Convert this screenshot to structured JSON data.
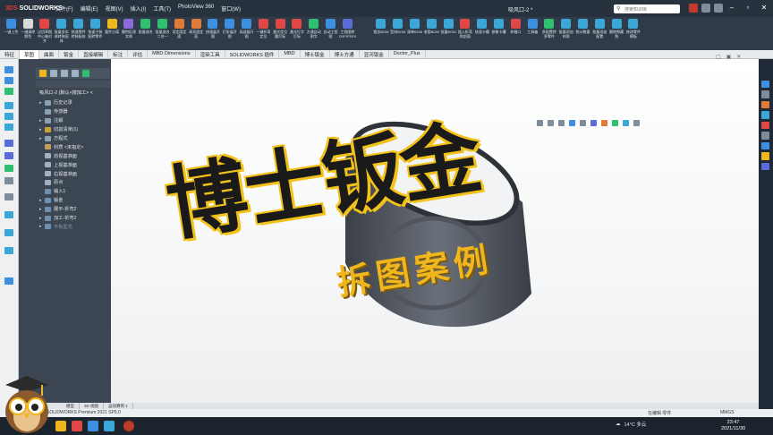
{
  "app": {
    "brand_prefix": "3DS",
    "brand": "SOLIDWORKS",
    "document_title": "吸风口-2 *",
    "search_placeholder": "搜索知识库"
  },
  "menu": [
    "文件(F)",
    "编辑(E)",
    "视图(V)",
    "插入(I)",
    "工具(T)",
    "PhotoView 360",
    "窗口(W)"
  ],
  "ribbon": [
    {
      "label": "一键上色",
      "color": "#3d8fe0"
    },
    {
      "label": "一键清除颜色",
      "color": "#d9d9d9"
    },
    {
      "label": "过切草图中心轴对齐",
      "color": "#e04747"
    },
    {
      "label": "批量多实体转装配体",
      "color": "#3aa7d8"
    },
    {
      "label": "快速零件转装配体",
      "color": "#3aa7d8"
    },
    {
      "label": "快速子装配转零件",
      "color": "#3aa7d8"
    },
    {
      "label": "要件分离",
      "color": "#f0b61e"
    },
    {
      "label": "删特征改实体",
      "color": "#8e6ad8"
    },
    {
      "label": "批量改名",
      "color": "#2fbf71"
    },
    {
      "label": "批量改名二合一",
      "color": "#2fbf71"
    },
    {
      "label": "设定固定面",
      "color": "#e07b39"
    },
    {
      "label": "高亮固定面",
      "color": "#e07b39"
    },
    {
      "label": "快速展开图",
      "color": "#3d8fe0"
    },
    {
      "label": "打折展开图",
      "color": "#3d8fe0"
    },
    {
      "label": "局部展开图",
      "color": "#3d8fe0"
    },
    {
      "label": "一键折弯定位",
      "color": "#e04747"
    },
    {
      "label": "激光定位圆打标",
      "color": "#e04747"
    },
    {
      "label": "激光打字打标",
      "color": "#e04747"
    },
    {
      "label": "方通自动割字",
      "color": "#2fbf71"
    },
    {
      "label": "自动工程图",
      "color": "#3d8fe0"
    },
    {
      "label": "工程图转DXF/PDF/DWG",
      "color": "#5b6bd8"
    },
    {
      "label": "",
      "color": "#2f3b48"
    },
    {
      "label": "钣金BOM",
      "color": "#3aa7d8"
    },
    {
      "label": "型材BOM",
      "color": "#3aa7d8"
    },
    {
      "label": "清单BOM",
      "color": "#3aa7d8"
    },
    {
      "label": "老版BOM",
      "color": "#3aa7d8"
    },
    {
      "label": "批量BOM",
      "color": "#3aa7d8"
    },
    {
      "label": "插入折弯和剖面",
      "color": "#e04747"
    },
    {
      "label": "快速卡槽",
      "color": "#3aa7d8"
    },
    {
      "label": "参数卡槽",
      "color": "#3aa7d8"
    },
    {
      "label": "补缝口",
      "color": "#e04747"
    },
    {
      "label": "工具箱",
      "color": "#3d8fe0"
    },
    {
      "label": "多配置转多零件",
      "color": "#2fbf71"
    },
    {
      "label": "批量添加材质",
      "color": "#3aa7d8"
    },
    {
      "label": "统计数量",
      "color": "#3aa7d8"
    },
    {
      "label": "批量添加配置",
      "color": "#3aa7d8"
    },
    {
      "label": "删除隐藏角",
      "color": "#3aa7d8"
    },
    {
      "label": "修改零件模板",
      "color": "#3aa7d8"
    }
  ],
  "tabs": [
    "特征",
    "草图",
    "曲面",
    "钣金",
    "直接编辑",
    "标注",
    "评估",
    "MBD Dimensions",
    "渲染工具",
    "SOLIDWORKS 插件",
    "MBD",
    "博士钣金",
    "博士方通",
    "显河钣金",
    "Doctor_Plus"
  ],
  "active_tab_index": 1,
  "tree": {
    "root": "吸风口-2 (默认<按加工> <",
    "items": [
      {
        "label": "历史记录",
        "arrow": "▸",
        "color": "#8aa0b4"
      },
      {
        "label": "传感器",
        "arrow": "",
        "color": "#8aa0b4"
      },
      {
        "label": "注解",
        "arrow": "▸",
        "color": "#8aa0b4"
      },
      {
        "label": "切割清单(1)",
        "arrow": "▸",
        "color": "#c9a23a"
      },
      {
        "label": "方程式",
        "arrow": "▸",
        "color": "#8aa0b4"
      },
      {
        "label": "材质 <未指定>",
        "arrow": "",
        "color": "#c49d5a"
      },
      {
        "label": "前视基准面",
        "arrow": "",
        "color": "#9fb2c4"
      },
      {
        "label": "上视基准面",
        "arrow": "",
        "color": "#9fb2c4"
      },
      {
        "label": "右视基准面",
        "arrow": "",
        "color": "#9fb2c4"
      },
      {
        "label": "原点",
        "arrow": "",
        "color": "#9fb2c4"
      },
      {
        "label": "输入1",
        "arrow": "",
        "color": "#6f8fb0"
      },
      {
        "label": "钣金",
        "arrow": "▸",
        "color": "#6f8fb0"
      },
      {
        "label": "展平-折弯2",
        "arrow": "▸",
        "color": "#6f8fb0"
      },
      {
        "label": "加工-折弯2",
        "arrow": "▸",
        "color": "#6f8fb0"
      },
      {
        "label": "平板型式",
        "arrow": "▸",
        "color": "#6f8fb0"
      }
    ]
  },
  "overlay": {
    "title": "博士钣金",
    "subtitle": "拆图案例"
  },
  "bottom_tabs": [
    "模型",
    "3D 视图",
    "运动算例 1"
  ],
  "status": {
    "left": "SOLIDWORKS Premium 2021 SP5.0",
    "right": "在编辑 零件",
    "units": "MMGS"
  },
  "taskbar": {
    "weather": "14°C 多云",
    "time": "23:47",
    "date": "2021/11/30"
  }
}
